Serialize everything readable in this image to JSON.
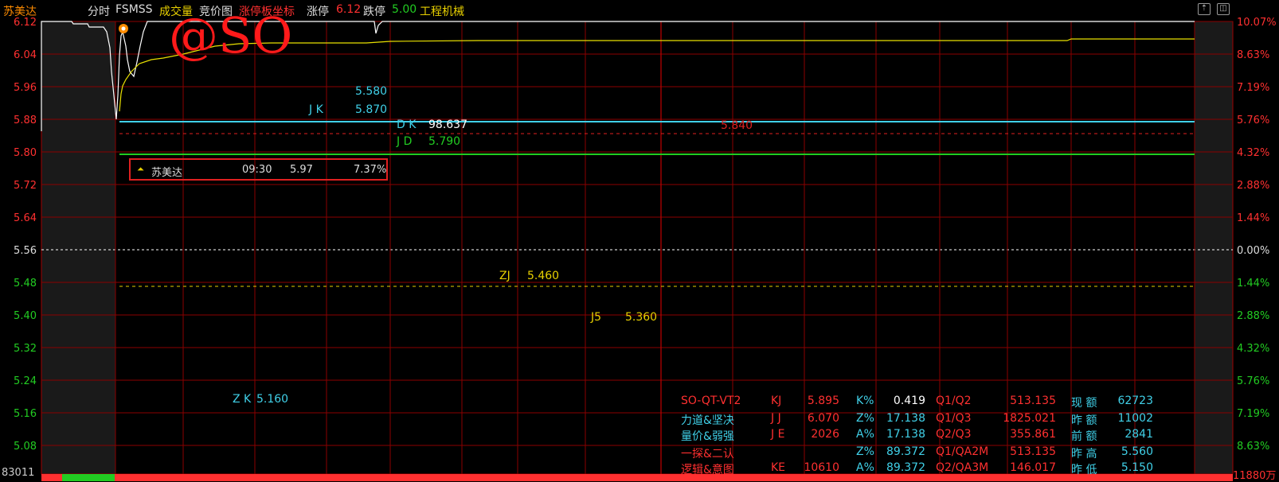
{
  "header": {
    "stock_name": "苏美达",
    "tab_intraday": "分时",
    "indicator": "FSMSS",
    "tab_volume": "成交量",
    "tab_auction": "竞价图",
    "limit_up_axis": "涨停板坐标",
    "limit_up_label": "涨停",
    "limit_up_value": "6.12",
    "limit_down_label": "跌停",
    "limit_down_value": "5.00",
    "sector": "工程机械"
  },
  "colors": {
    "up": "#ff3030",
    "down": "#22cc22",
    "grid": "#8b0000",
    "price": "#ffffff",
    "avg": "#ffff00",
    "cyan": "#40d0e8"
  },
  "left_axis": [
    "6.12",
    "6.04",
    "5.96",
    "5.88",
    "5.80",
    "5.72",
    "5.64",
    "5.56",
    "5.48",
    "5.40",
    "5.32",
    "5.24",
    "5.16",
    "5.08"
  ],
  "right_axis": [
    "10.07%",
    "8.63%",
    "7.19%",
    "5.76%",
    "4.32%",
    "2.88%",
    "1.44%",
    "0.00%",
    "1.44%",
    "2.88%",
    "4.32%",
    "5.76%",
    "7.19%",
    "8.63%"
  ],
  "markers": {
    "v5580": "5.580",
    "jk_label": "J K",
    "jk_value": "5.870",
    "dk_label": "D K",
    "dk_value": "98.637",
    "jd_label": "J D",
    "jd_value": "5.790",
    "red_center": "5.840",
    "zj_label": "ZJ",
    "zj_value": "5.460",
    "j5_label": "J5",
    "j5_value": "5.360",
    "zk_label": "Z K",
    "zk_value": "5.160"
  },
  "stock_box": {
    "name": "苏美达",
    "time": "09:30",
    "price": "5.97",
    "pct": "7.37%"
  },
  "stats": {
    "r1": [
      "SO-QT-VT2",
      "KJ",
      "5.895",
      "K%",
      "0.419",
      "Q1/Q2",
      "513.135",
      "现 额",
      "62723"
    ],
    "r2": [
      "力道&坚决",
      "J J",
      "6.070",
      "Z%",
      "17.138",
      "Q1/Q3",
      "1825.021",
      "昨 额",
      "11002"
    ],
    "r3": [
      "量价&弱强",
      "J E",
      "2026",
      "A%",
      "17.138",
      "Q2/Q3",
      "355.861",
      "前 额",
      "2841"
    ],
    "r4": [
      "一探&二认",
      "",
      "",
      "Z%",
      "89.372",
      "Q1/QA2M",
      "513.135",
      "昨 高",
      "5.560"
    ],
    "r5": [
      "逻辑&意图",
      "KE",
      "10610",
      "A%",
      "89.372",
      "Q2/QA3M",
      "146.017",
      "昨 低",
      "5.150"
    ]
  },
  "watermark": "@SO",
  "bottom_left": "83011",
  "bottom_right": "11880万"
}
